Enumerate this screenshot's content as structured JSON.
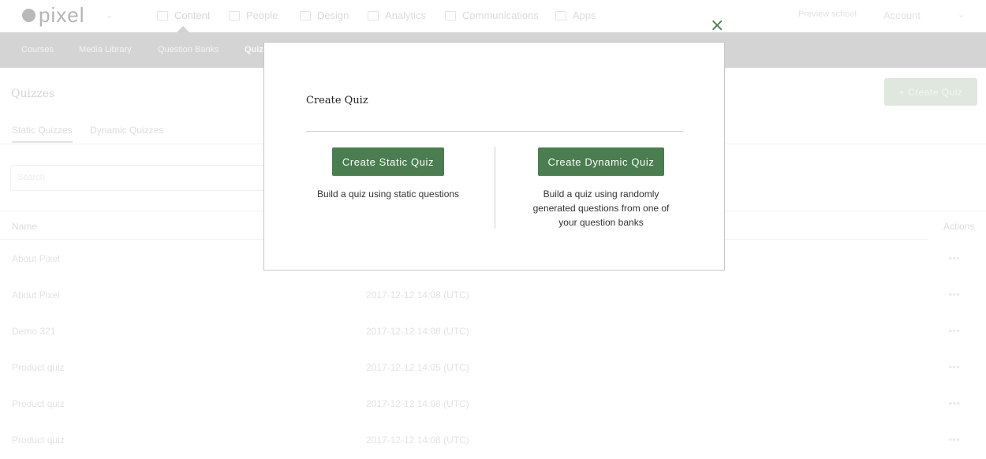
{
  "topnav": {
    "logo": "pixel",
    "items": [
      {
        "label": "Content",
        "icon": "pencil-icon"
      },
      {
        "label": "People",
        "icon": "people-icon"
      },
      {
        "label": "Design",
        "icon": "brush-icon"
      },
      {
        "label": "Analytics",
        "icon": "chart-icon"
      },
      {
        "label": "Communications",
        "icon": "chat-icon"
      },
      {
        "label": "Apps",
        "icon": "apps-icon"
      }
    ],
    "preview": "Preview school",
    "account": "Account"
  },
  "subnav": {
    "items": [
      "Courses",
      "Media Library",
      "Question Banks",
      "Quiz"
    ]
  },
  "page": {
    "title": "Quizzes",
    "create_button": "+ Create Quiz",
    "tabs": [
      "Static Quizzes",
      "Dynamic Quizzes"
    ],
    "search_placeholder": "Search"
  },
  "table": {
    "headers": {
      "name": "Name",
      "actions": "Actions"
    },
    "rows": [
      {
        "name": "About Pixel",
        "date": ""
      },
      {
        "name": "About Pixel",
        "date": "2017-12-12 14:08 (UTC)"
      },
      {
        "name": "Demo 321",
        "date": "2017-12-12 14:08 (UTC)"
      },
      {
        "name": "Product quiz",
        "date": "2017-12-12 14:05 (UTC)"
      },
      {
        "name": "Product quiz",
        "date": "2017-12-12 14:08 (UTC)"
      },
      {
        "name": "Product quiz",
        "date": "2017-12-12 14:08 (UTC)"
      }
    ],
    "actions_glyph": "•••"
  },
  "modal": {
    "close": "×",
    "title": "Create Quiz",
    "static_button": "Create Static Quiz",
    "static_desc": "Build a quiz using static questions",
    "dynamic_button": "Create Dynamic Quiz",
    "dynamic_desc_1": "Build a quiz using randomly",
    "dynamic_desc_2": "generated questions from one of",
    "dynamic_desc_3": "your question banks"
  },
  "colors": {
    "accent": "#4a7d4f",
    "subnav_bg": "#d4d4d4"
  }
}
